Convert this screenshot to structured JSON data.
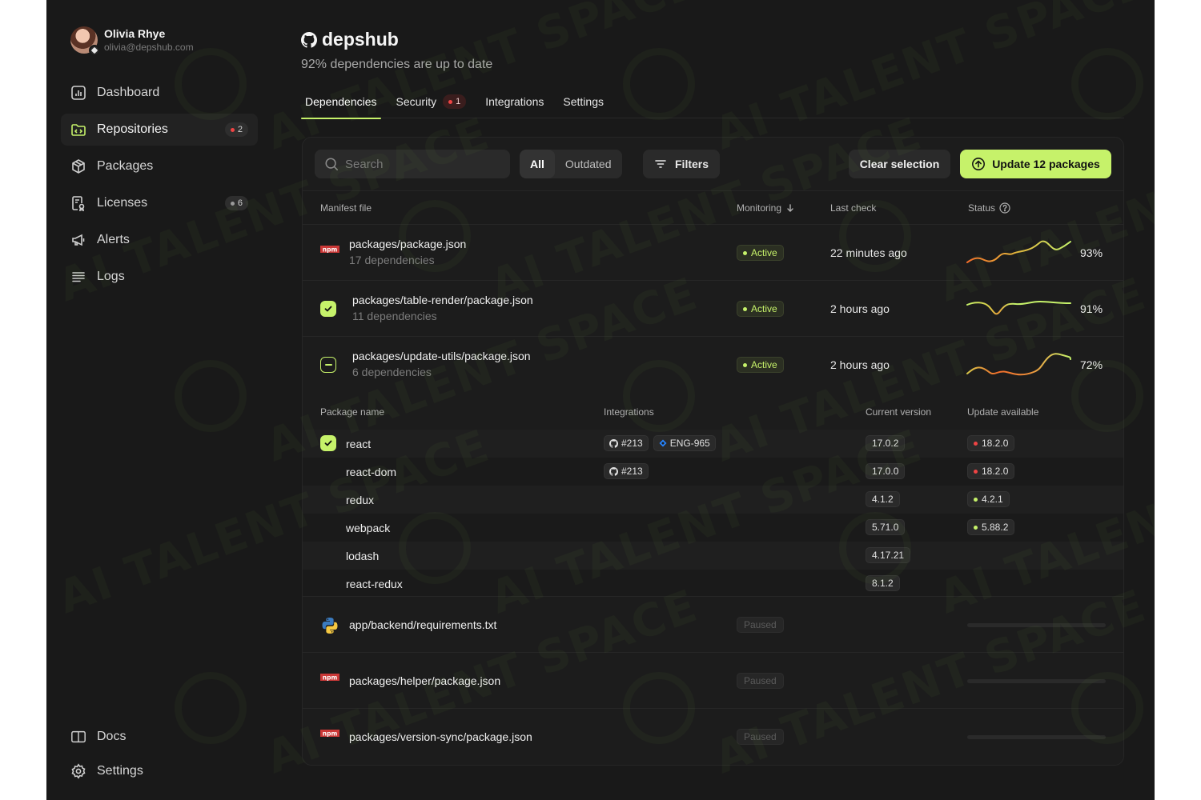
{
  "user": {
    "name": "Olivia Rhye",
    "email": "olivia@depshub.com"
  },
  "sidebar": {
    "items": [
      {
        "label": "Dashboard",
        "icon": "dashboard-icon"
      },
      {
        "label": "Repositories",
        "icon": "folder-code-icon",
        "badge": "2",
        "badge_color": "#ef4444"
      },
      {
        "label": "Packages",
        "icon": "box-icon"
      },
      {
        "label": "Licenses",
        "icon": "license-icon",
        "badge": "6",
        "badge_color": "#9a9a9a"
      },
      {
        "label": "Alerts",
        "icon": "megaphone-icon"
      },
      {
        "label": "Logs",
        "icon": "lines-icon"
      }
    ],
    "bottom": [
      {
        "label": "Docs",
        "icon": "book-icon"
      },
      {
        "label": "Settings",
        "icon": "gear-icon"
      }
    ]
  },
  "repo": {
    "title": "depshub",
    "subtitle": "92% dependencies are up to date"
  },
  "tabs": [
    {
      "label": "Dependencies"
    },
    {
      "label": "Security",
      "badge": "1"
    },
    {
      "label": "Integrations"
    },
    {
      "label": "Settings"
    }
  ],
  "toolbar": {
    "search_placeholder": "Search",
    "segments": [
      "All",
      "Outdated"
    ],
    "filters_label": "Filters",
    "clear_label": "Clear selection",
    "update_label": "Update 12 packages"
  },
  "table": {
    "headers": {
      "manifest": "Manifest file",
      "monitoring": "Monitoring",
      "last_check": "Last check",
      "status": "Status"
    },
    "manifests": [
      {
        "file": "packages/package.json",
        "deps": "17 dependencies",
        "monitoring": "Active",
        "last_check": "22 minutes ago",
        "status": "93%",
        "icon": "npm-icon"
      },
      {
        "file": "packages/table-render/package.json",
        "deps": "11 dependencies",
        "monitoring": "Active",
        "last_check": "2 hours ago",
        "status": "91%",
        "selection": "checked"
      },
      {
        "file": "packages/update-utils/package.json",
        "deps": "6 dependencies",
        "monitoring": "Active",
        "last_check": "2 hours ago",
        "status": "72%",
        "selection": "indeterminate"
      },
      {
        "file": "app/backend/requirements.txt",
        "monitoring": "Paused",
        "icon": "python-icon"
      },
      {
        "file": "packages/helper/package.json",
        "monitoring": "Paused",
        "icon": "npm-icon"
      },
      {
        "file": "packages/version-sync/package.json",
        "monitoring": "Paused",
        "icon": "npm-icon"
      }
    ],
    "package_headers": {
      "name": "Package name",
      "integrations": "Integrations",
      "current": "Current version",
      "update": "Update available"
    },
    "packages": [
      {
        "name": "react",
        "integrations": [
          "#213",
          "ENG-965"
        ],
        "current": "17.0.2",
        "update": "18.2.0",
        "update_color": "#ef4444",
        "checked": true
      },
      {
        "name": "react-dom",
        "integrations": [
          "#213"
        ],
        "current": "17.0.0",
        "update": "18.2.0",
        "update_color": "#ef4444"
      },
      {
        "name": "redux",
        "integrations": [],
        "current": "4.1.2",
        "update": "4.2.1",
        "update_color": "#c6f26a"
      },
      {
        "name": "webpack",
        "integrations": [],
        "current": "5.71.0",
        "update": "5.88.2",
        "update_color": "#c6f26a"
      },
      {
        "name": "lodash",
        "integrations": [],
        "current": "4.17.21"
      },
      {
        "name": "react-redux",
        "integrations": [],
        "current": "8.1.2"
      }
    ]
  },
  "watermark": "AI TALENT SPACE",
  "colors": {
    "accent": "#c6f26a",
    "danger": "#ef4444",
    "background": "#191919"
  }
}
